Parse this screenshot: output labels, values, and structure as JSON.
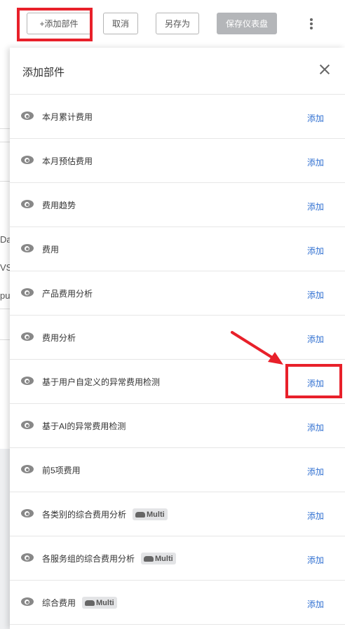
{
  "toolbar": {
    "add_widget": "+添加部件",
    "cancel": "取消",
    "save_as": "另存为",
    "save_dashboard": "保存仪表盘"
  },
  "background_fragments": [
    "Da",
    "VS",
    "pu"
  ],
  "panel": {
    "title": "添加部件",
    "items": [
      {
        "label": "本月累计费用",
        "action": "添加"
      },
      {
        "label": "本月预估费用",
        "action": "添加"
      },
      {
        "label": "费用趋势",
        "action": "添加"
      },
      {
        "label": "费用",
        "action": "添加"
      },
      {
        "label": "产品费用分析",
        "action": "添加"
      },
      {
        "label": "费用分析",
        "action": "添加"
      },
      {
        "label": "基于用户自定义的异常费用检测",
        "action": "添加"
      },
      {
        "label": "基于AI的异常费用检测",
        "action": "添加"
      },
      {
        "label": "前5项费用",
        "action": "添加"
      },
      {
        "label": "各类别的综合费用分析",
        "badge": "Multi",
        "action": "添加"
      },
      {
        "label": "各服务组的综合费用分析",
        "badge": "Multi",
        "action": "添加"
      },
      {
        "label": "综合费用",
        "badge": "Multi",
        "action": "添加"
      }
    ]
  },
  "colors": {
    "accent_link": "#2f6fd1",
    "highlight": "#e8202a"
  },
  "icons": [
    "eye-icon",
    "close-icon",
    "kebab-menu-icon",
    "cloud-icon"
  ]
}
